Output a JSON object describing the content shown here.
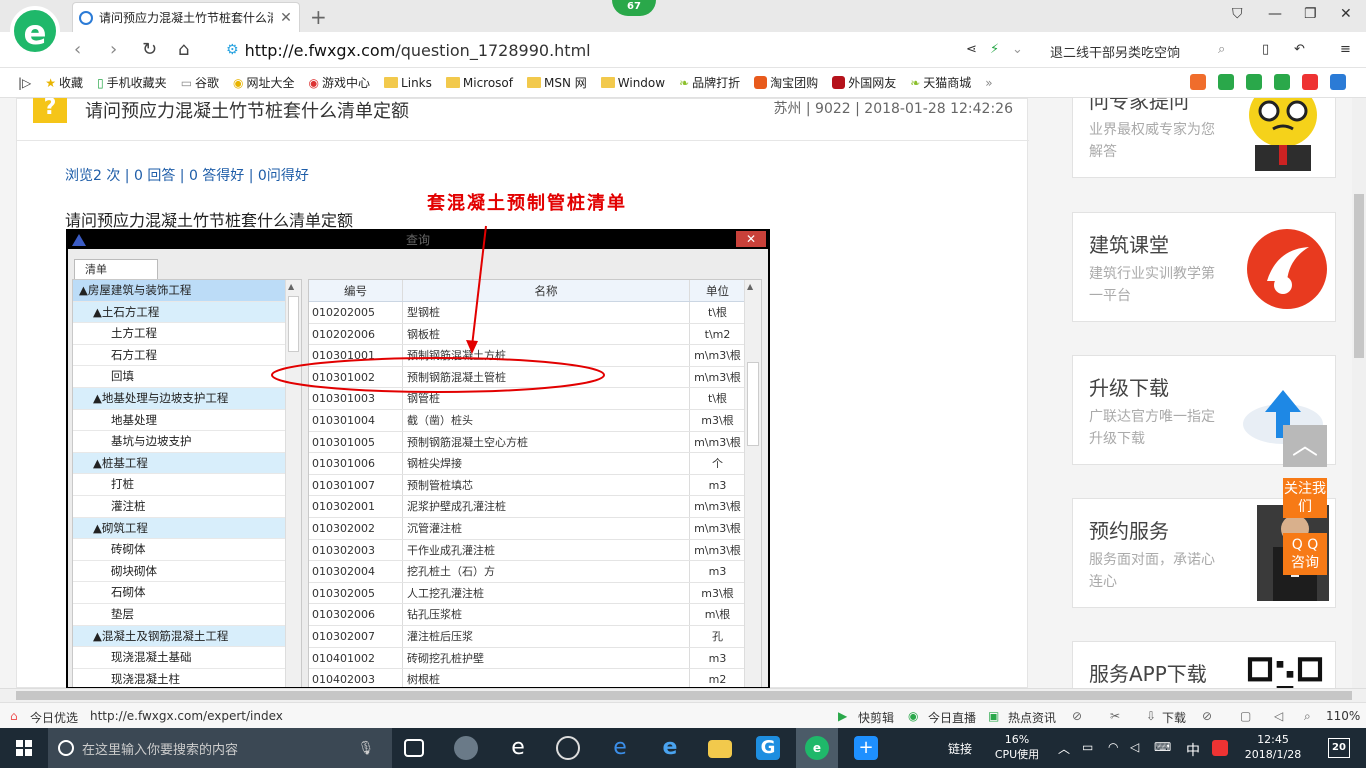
{
  "browser": {
    "tab_title": "请问预应力混凝土竹节桩套什么清单定额",
    "badge": "67",
    "url_host": "http://e.fwxgx.com",
    "url_path": "/question_1728990.html",
    "search_text": "退二线干部另类吃空饷",
    "zoom": "110%"
  },
  "favorites": [
    "收藏",
    "手机收藏夹",
    "谷歌",
    "网址大全",
    "游戏中心",
    "Links",
    "Microsof",
    "MSN 网",
    "Window",
    "品牌打折",
    "淘宝团购",
    "外国网友",
    "天猫商城"
  ],
  "question": {
    "title": "请问预应力混凝土竹节桩套什么清单定额",
    "meta": "苏州 | 9022 | 2018-01-28 12:42:26",
    "stats": "浏览2 次 | 0 回答 | 0 答得好 | 0问得好",
    "body": "请问预应力混凝土竹节桩套什么清单定额",
    "annotation": "套混凝土预制管桩清单"
  },
  "dialog": {
    "title": "查询",
    "tab": "清单",
    "close": "✕",
    "tree": [
      {
        "level": 0,
        "label": "▲房屋建筑与装饰工程"
      },
      {
        "level": 1,
        "label": "▲土石方工程"
      },
      {
        "level": 2,
        "label": "土方工程"
      },
      {
        "level": 2,
        "label": "石方工程"
      },
      {
        "level": 2,
        "label": "回填"
      },
      {
        "level": 1,
        "label": "▲地基处理与边坡支护工程"
      },
      {
        "level": 2,
        "label": "地基处理"
      },
      {
        "level": 2,
        "label": "基坑与边坡支护"
      },
      {
        "level": 1,
        "label": "▲桩基工程"
      },
      {
        "level": 2,
        "label": "打桩"
      },
      {
        "level": 2,
        "label": "灌注桩"
      },
      {
        "level": 1,
        "label": "▲砌筑工程"
      },
      {
        "level": 2,
        "label": "砖砌体"
      },
      {
        "level": 2,
        "label": "砌块砌体"
      },
      {
        "level": 2,
        "label": "石砌体"
      },
      {
        "level": 2,
        "label": "垫层"
      },
      {
        "level": 1,
        "label": "▲混凝土及钢筋混凝土工程"
      },
      {
        "level": 2,
        "label": "现浇混凝土基础"
      },
      {
        "level": 2,
        "label": "现浇混凝土柱"
      }
    ],
    "columns": [
      "编号",
      "名称",
      "单位"
    ],
    "rows": [
      [
        "010202005",
        "型钢桩",
        "t\\根"
      ],
      [
        "010202006",
        "钢板桩",
        "t\\m2"
      ],
      [
        "010301001",
        "预制钢筋混凝土方桩",
        "m\\m3\\根"
      ],
      [
        "010301002",
        "预制钢筋混凝土管桩",
        "m\\m3\\根"
      ],
      [
        "010301003",
        "钢管桩",
        "t\\根"
      ],
      [
        "010301004",
        "截（凿）桩头",
        "m3\\根"
      ],
      [
        "010301005",
        "预制钢筋混凝土空心方桩",
        "m\\m3\\根"
      ],
      [
        "010301006",
        "钢桩尖焊接",
        "个"
      ],
      [
        "010301007",
        "预制管桩填芯",
        "m3"
      ],
      [
        "010302001",
        "泥浆护壁成孔灌注桩",
        "m\\m3\\根"
      ],
      [
        "010302002",
        "沉管灌注桩",
        "m\\m3\\根"
      ],
      [
        "010302003",
        "干作业成孔灌注桩",
        "m\\m3\\根"
      ],
      [
        "010302004",
        "挖孔桩土（石）方",
        "m3"
      ],
      [
        "010302005",
        "人工挖孔灌注桩",
        "m3\\根"
      ],
      [
        "010302006",
        "钻孔压浆桩",
        "m\\根"
      ],
      [
        "010302007",
        "灌注桩后压浆",
        "孔"
      ],
      [
        "010401002",
        "砖砌挖孔桩护壁",
        "m3"
      ],
      [
        "010402003",
        "树根桩",
        "m2"
      ]
    ]
  },
  "sidebar": [
    {
      "title": "问专家提问",
      "desc": "业界最权威专家为您解答"
    },
    {
      "title": "建筑课堂",
      "desc": "建筑行业实训教学第一平台"
    },
    {
      "title": "升级下载",
      "desc": "广联达官方唯一指定升级下载"
    },
    {
      "title": "预约服务",
      "desc": "服务面对面，承诺心连心"
    },
    {
      "title": "服务APP下载",
      "desc": ""
    }
  ],
  "float_buttons": {
    "follow": "关注我们",
    "qq": "Q Q 咨询",
    "top": "︿"
  },
  "status": {
    "today": "今日优选",
    "link_url": "http://e.fwxgx.com/expert/index",
    "quick_clip": "快剪辑",
    "live": "今日直播",
    "hot_news": "热点资讯",
    "download": "下载"
  },
  "taskbar": {
    "search_placeholder": "在这里输入你要搜索的内容",
    "link_label": "链接",
    "cpu": "16%",
    "cpu_label": "CPU使用",
    "ime": "中",
    "time": "12:45",
    "date": "2018/1/28",
    "notifications": "20"
  }
}
